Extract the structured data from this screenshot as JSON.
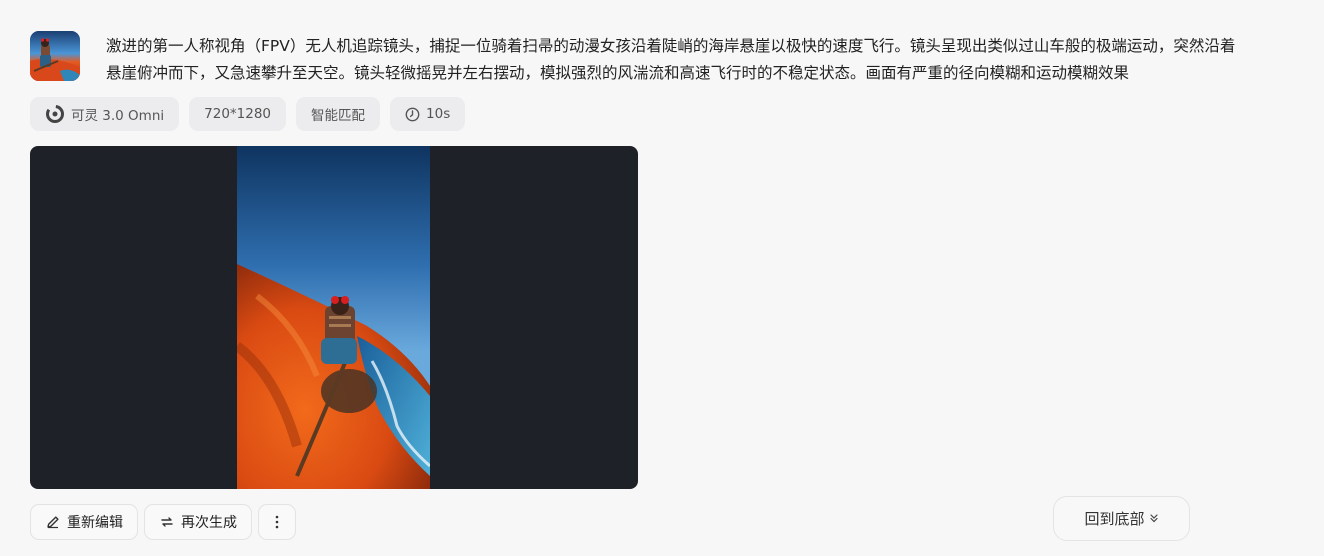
{
  "prompt": {
    "text": "激进的第一人称视角（FPV）无人机追踪镜头，捕捉一位骑着扫帚的动漫女孩沿着陡峭的海岸悬崖以极快的速度飞行。镜头呈现出类似过山车般的极端运动，突然沿着悬崖俯冲而下，又急速攀升至天空。镜头轻微摇晃并左右摆动，模拟强烈的风湍流和高速飞行时的不稳定状态。画面有严重的径向模糊和运动模糊效果"
  },
  "tags": {
    "model": "可灵 3.0 Omni",
    "resolution": "720*1280",
    "mode": "智能匹配",
    "duration": "10s"
  },
  "icons": {
    "model": "kling-logo-icon",
    "duration": "clock-icon",
    "edit": "pencil-icon",
    "regenerate": "repeat-icon",
    "more": "more-vertical-icon",
    "scroll": "chevron-down-double-icon"
  },
  "actions": {
    "edit_label": "重新编辑",
    "regenerate_label": "再次生成"
  },
  "scroll_bottom": {
    "label": "回到底部"
  },
  "colors": {
    "background": "#f7f7f8",
    "tag_bg": "#ececee",
    "player_bg": "#1f2128"
  }
}
